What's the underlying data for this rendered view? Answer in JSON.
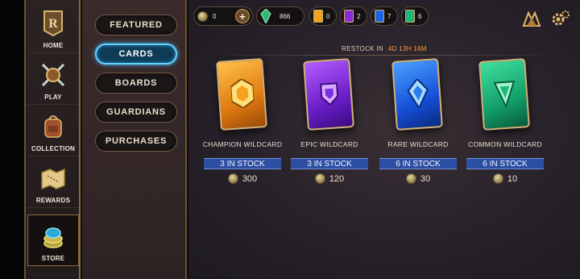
{
  "nav": {
    "items": [
      {
        "label": "HOME",
        "icon": "home-logo-icon"
      },
      {
        "label": "PLAY",
        "icon": "crossed-swords-shield-icon"
      },
      {
        "label": "COLLECTION",
        "icon": "backpack-icon"
      },
      {
        "label": "REWARDS",
        "icon": "treasure-map-icon"
      },
      {
        "label": "STORE",
        "icon": "coin-stack-icon"
      }
    ],
    "active": "STORE"
  },
  "categories": {
    "items": [
      "FEATURED",
      "CARDS",
      "BOARDS",
      "GUARDIANS",
      "PURCHASES"
    ],
    "active": "CARDS"
  },
  "currency": {
    "coins": "0",
    "shards": "866",
    "champion_wildcards": "0",
    "epic_wildcards": "2",
    "rare_wildcards": "7",
    "common_wildcards": "6"
  },
  "restock": {
    "label": "RESTOCK IN",
    "time": "4D 13H 16M"
  },
  "wildcards": [
    {
      "name": "CHAMPION WILDCARD",
      "stock": "3 IN STOCK",
      "price": "300",
      "color": "#f0a21e"
    },
    {
      "name": "EPIC WILDCARD",
      "stock": "3 IN STOCK",
      "price": "120",
      "color": "#8a2bd8"
    },
    {
      "name": "RARE WILDCARD",
      "stock": "6 IN STOCK",
      "price": "30",
      "color": "#1f63e0"
    },
    {
      "name": "COMMON WILDCARD",
      "stock": "6 IN STOCK",
      "price": "10",
      "color": "#1db37a"
    }
  ],
  "colors": {
    "accent": "#66d3ff",
    "gold_trim": "#8a6b3c",
    "restock_time": "#ff9a3a",
    "stock_banner": "#2d4fa3"
  }
}
